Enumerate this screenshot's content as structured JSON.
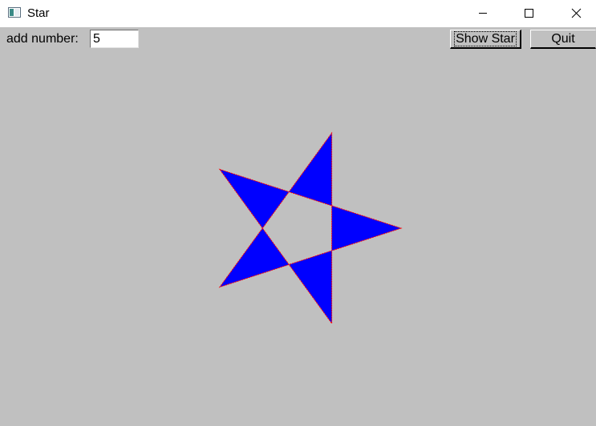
{
  "window": {
    "title": "Star",
    "background_color": "#c0c0c0",
    "controls": {
      "minimize_icon": "minimize-icon",
      "maximize_icon": "maximize-icon",
      "close_icon": "close-icon"
    }
  },
  "toolbar": {
    "add_number_label": "add number:",
    "number_value": "5",
    "show_star_label": "Show Star",
    "quit_label": "Quit"
  },
  "star": {
    "points": 5,
    "fill_color": "#0000ff",
    "outline_color": "#ff0000"
  }
}
